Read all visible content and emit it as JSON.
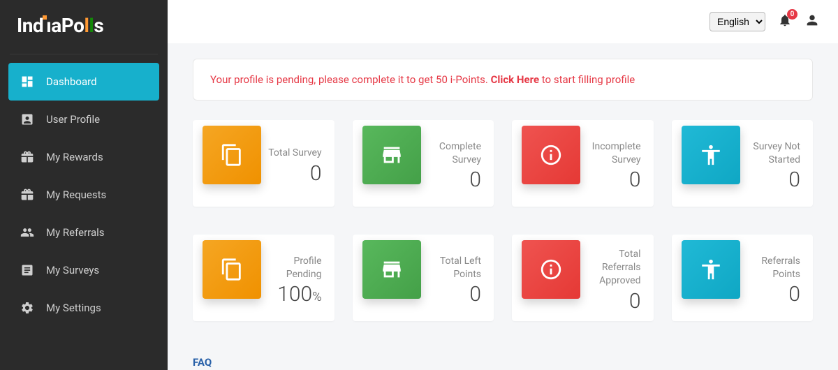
{
  "brand": {
    "name": "IndiaPolls"
  },
  "sidebar": {
    "items": [
      {
        "label": "Dashboard"
      },
      {
        "label": "User Profile"
      },
      {
        "label": "My Rewards"
      },
      {
        "label": "My Requests"
      },
      {
        "label": "My Referrals"
      },
      {
        "label": "My Surveys"
      },
      {
        "label": "My Settings"
      }
    ]
  },
  "topbar": {
    "language_selected": "English",
    "notifications_count": "0"
  },
  "banner": {
    "prefix": "Your profile is pending, please complete it to get 50 i-Points. ",
    "link": "Click Here",
    "suffix": " to start filling profile"
  },
  "cards_row1": [
    {
      "label": "Total Survey",
      "value": "0"
    },
    {
      "label": "Complete Survey",
      "value": "0"
    },
    {
      "label": "Incomplete Survey",
      "value": "0"
    },
    {
      "label": "Survey Not Started",
      "value": "0"
    }
  ],
  "cards_row2": [
    {
      "label": "Profile Pending",
      "value": "100",
      "suffix": "%"
    },
    {
      "label": "Total Left Points",
      "value": "0"
    },
    {
      "label": "Total Referrals Approved",
      "value": "0"
    },
    {
      "label": "Referrals Points",
      "value": "0"
    }
  ],
  "footer": {
    "faq": "FAQ"
  }
}
